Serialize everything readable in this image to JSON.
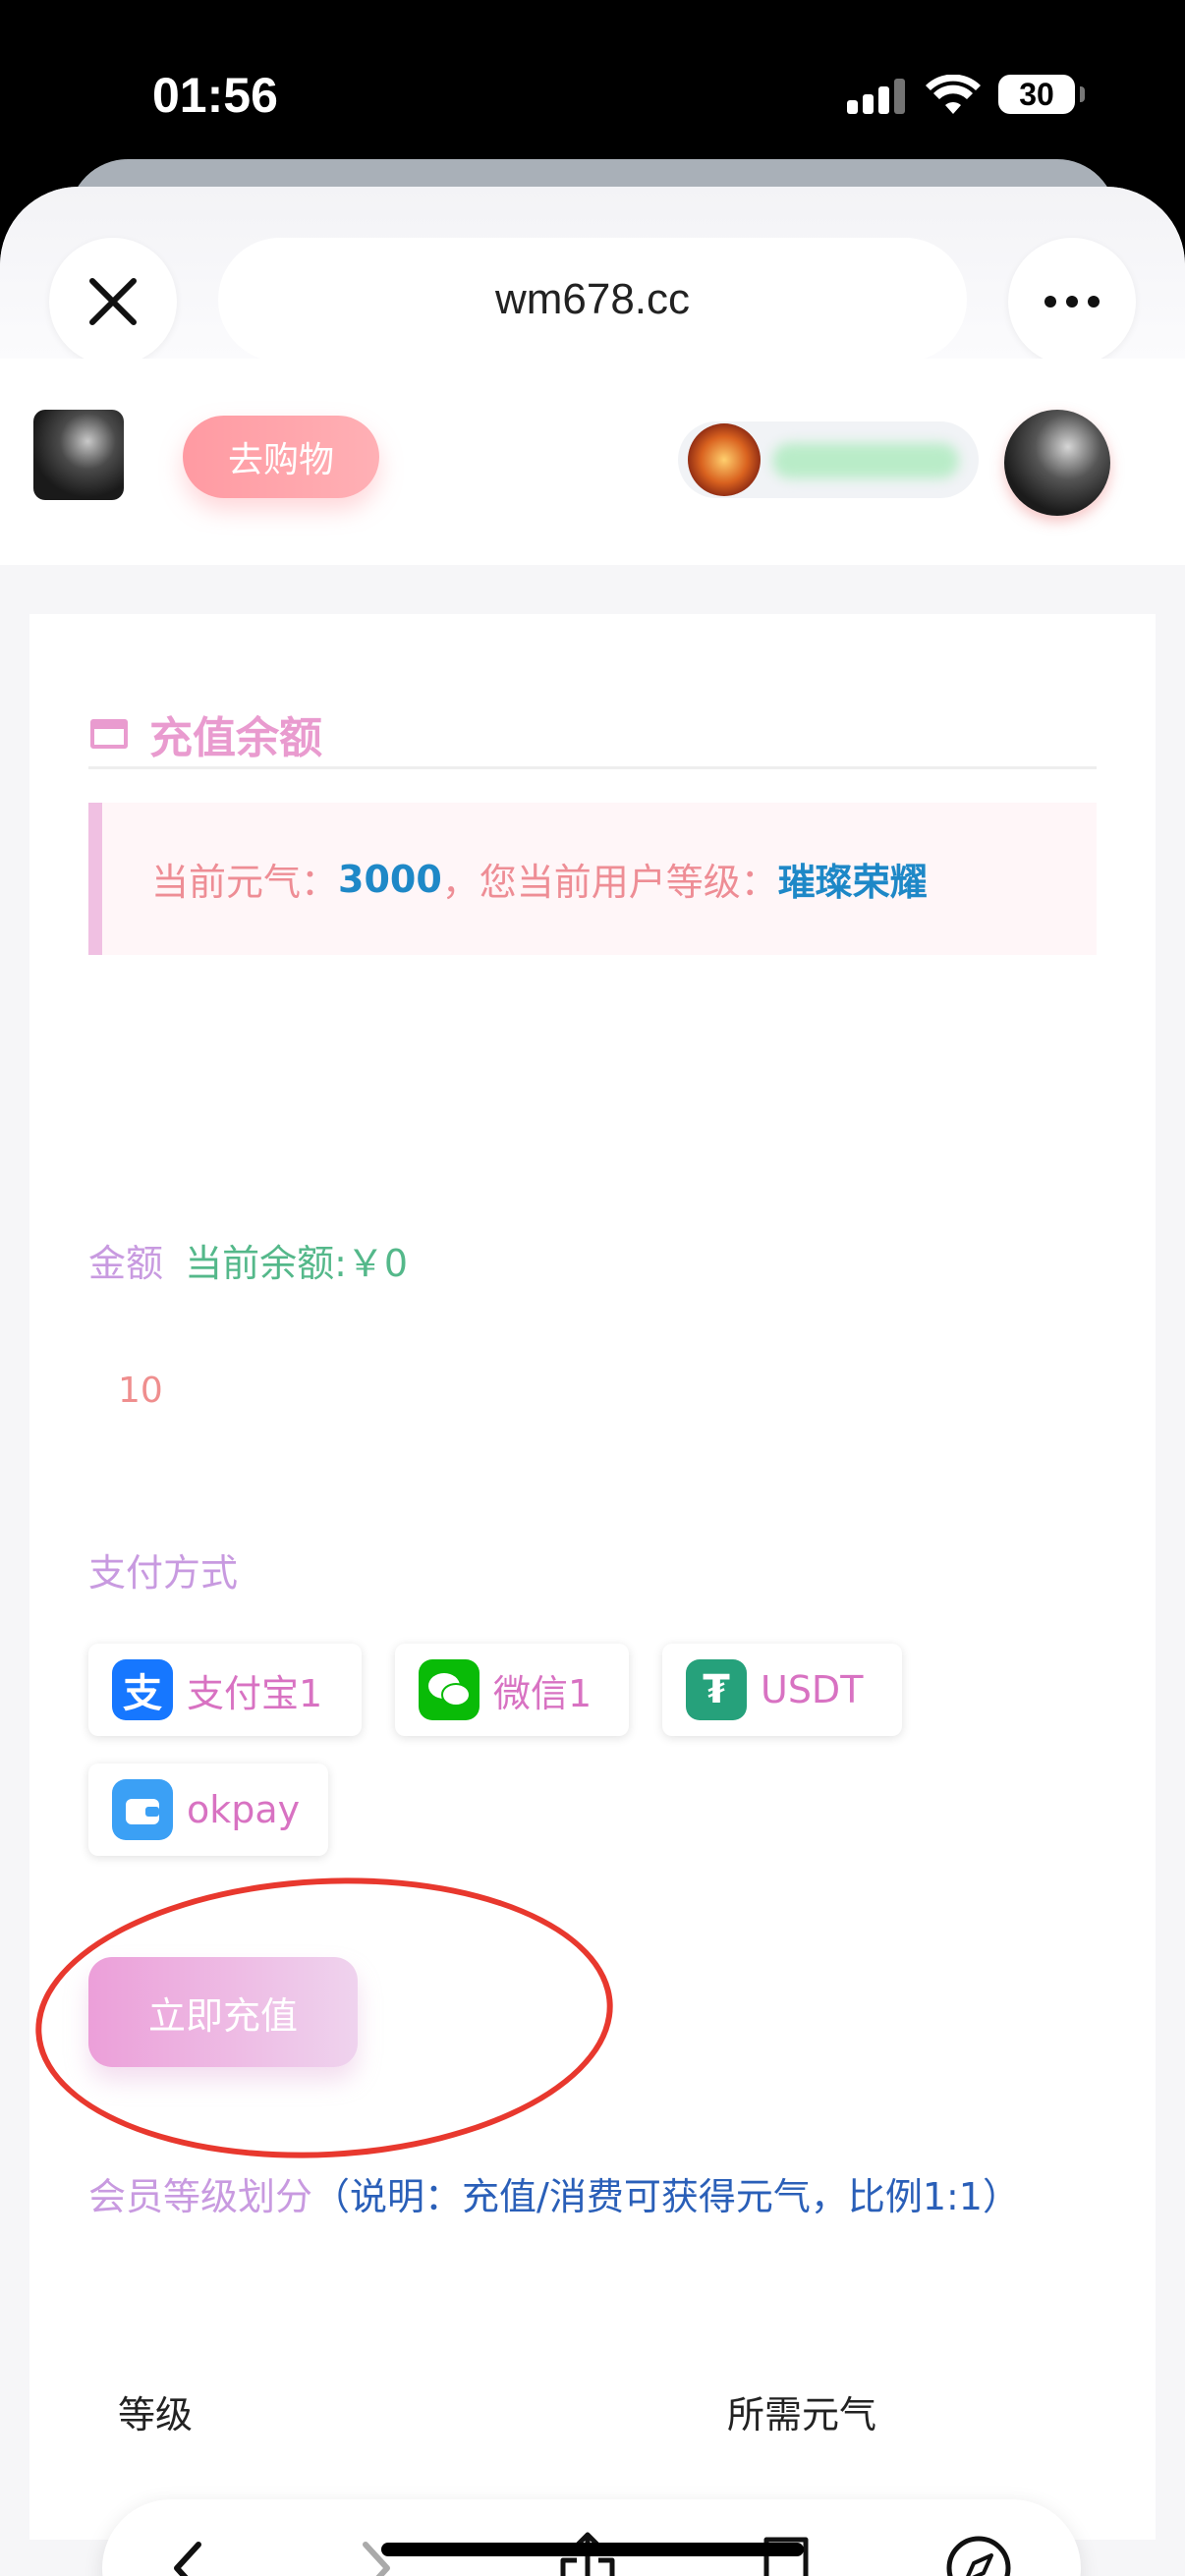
{
  "status_bar": {
    "time": "01:56",
    "battery": "30"
  },
  "browser": {
    "url": "wm678.cc"
  },
  "header": {
    "shop_button": "去购物"
  },
  "recharge": {
    "title": "充值余额",
    "notice": {
      "prefix": "当前元气：",
      "points": "3000",
      "middle": "，您当前用户等级：",
      "level": "璀璨荣耀"
    },
    "amount_label": "金额",
    "balance_label": "当前余额:￥0",
    "amount_value": "10",
    "payment_label": "支付方式",
    "payment_methods": [
      {
        "label": "支付宝1",
        "icon": "alipay-icon",
        "color": "#1677ff"
      },
      {
        "label": "微信1",
        "icon": "wechat-icon",
        "color": "#09bb07"
      },
      {
        "label": "USDT",
        "icon": "tether-icon",
        "color": "#26a17b"
      },
      {
        "label": "okpay",
        "icon": "wallet-icon",
        "color": "#3ba0f5"
      }
    ],
    "submit_button": "立即充值",
    "member_title": "会员等级划分",
    "member_note": "（说明：充值/消费可获得元气，比例1:1）",
    "table_headers": [
      "等级",
      "所需元气"
    ]
  },
  "annotation": {
    "color": "#e8382e"
  }
}
